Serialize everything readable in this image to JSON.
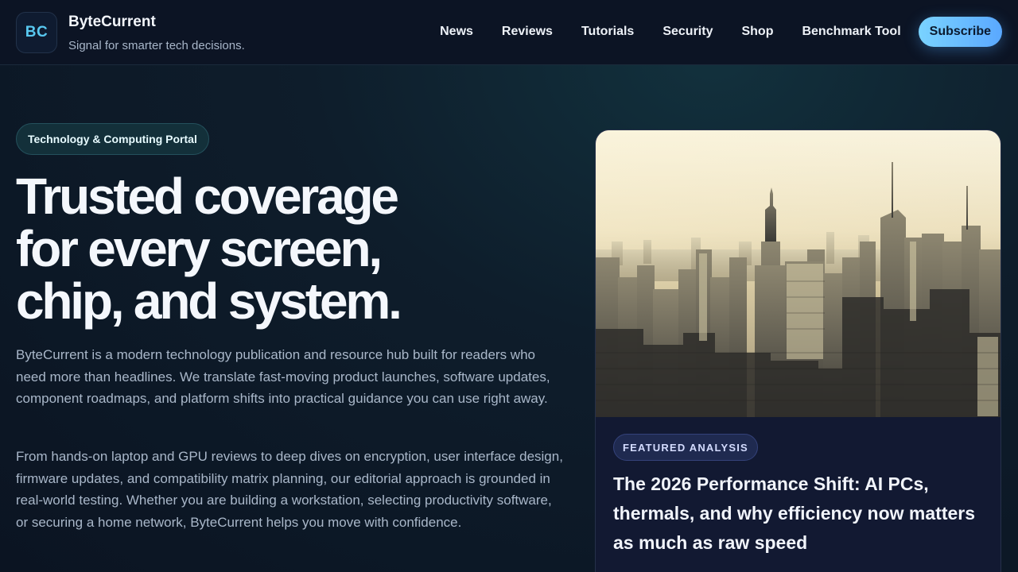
{
  "header": {
    "logo_text": "BC",
    "brand_name": "ByteCurrent",
    "tagline": "Signal for smarter tech decisions.",
    "nav": [
      "News",
      "Reviews",
      "Tutorials",
      "Security",
      "Shop",
      "Benchmark Tool"
    ],
    "subscribe_label": "Subscribe"
  },
  "hero": {
    "pill": "Technology & Computing Portal",
    "title_lines": [
      "Trusted coverage",
      "for every screen,",
      "chip, and system."
    ],
    "paragraph_1": "ByteCurrent is a modern technology publication and resource hub built for readers who need more than headlines. We translate fast-moving product launches, software updates, component roadmaps, and platform shifts into practical guidance you can use right away.",
    "paragraph_2": "From hands-on laptop and GPU reviews to deep dives on encryption, user interface design, firmware updates, and compatibility matrix planning, our editorial approach is grounded in real-world testing. Whether you are building a workstation, selecting productivity software, or securing a home network, ByteCurrent helps you move with confidence."
  },
  "featured": {
    "badge": "FEATURED ANALYSIS",
    "title": "The 2026 Performance Shift: AI PCs, thermals, and why efficiency now matters as much as raw speed",
    "image": "city-skyline-photo"
  },
  "colors": {
    "accent": "#58c8f0",
    "subscribe_gradient_start": "#7ad3ff",
    "subscribe_gradient_end": "#5aa8ff",
    "background": "#0e1d2b"
  }
}
